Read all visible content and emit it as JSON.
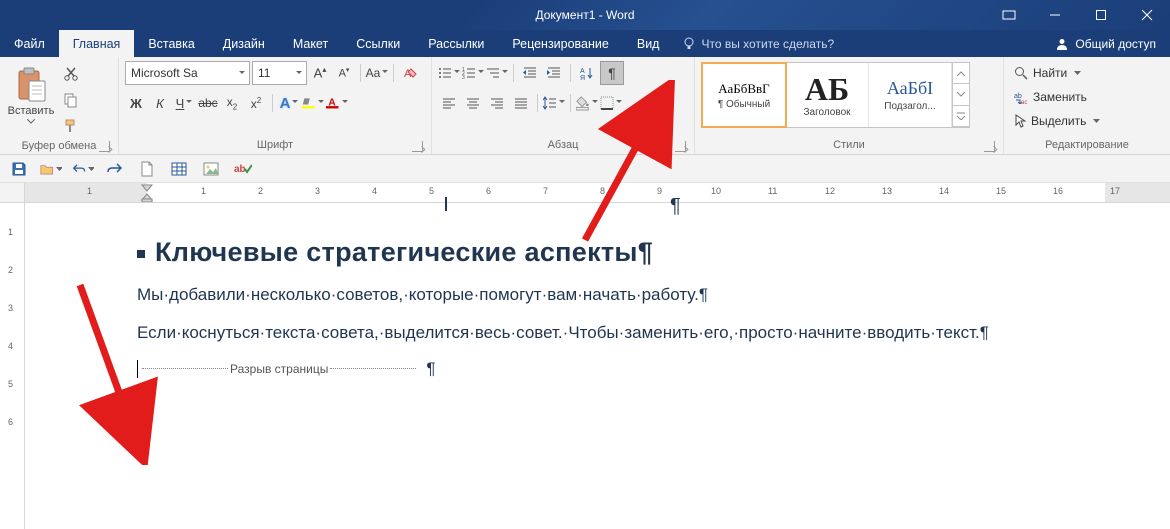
{
  "window": {
    "title": "Документ1 - Word"
  },
  "tabs": {
    "file": "Файл",
    "items": [
      "Главная",
      "Вставка",
      "Дизайн",
      "Макет",
      "Ссылки",
      "Рассылки",
      "Рецензирование",
      "Вид"
    ],
    "active_index": 0,
    "tell_me_placeholder": "Что вы хотите сделать?",
    "share": "Общий доступ"
  },
  "ribbon": {
    "clipboard": {
      "label": "Буфер обмена",
      "paste": "Вставить"
    },
    "font": {
      "label": "Шрифт",
      "name": "Microsoft Sa",
      "size": "11"
    },
    "paragraph": {
      "label": "Абзац"
    },
    "styles": {
      "label": "Стили",
      "items": [
        {
          "preview": "АаБбВвГ",
          "name": "¶ Обычный",
          "selected": true
        },
        {
          "preview": "АБ",
          "name": "Заголовок",
          "selected": false
        },
        {
          "preview": "АаБбІ",
          "name": "Подзагол...",
          "selected": false
        }
      ]
    },
    "editing": {
      "label": "Редактирование",
      "find": "Найти",
      "replace": "Заменить",
      "select": "Выделить"
    }
  },
  "ruler": {
    "h_numbers": [
      "1",
      "1",
      "2",
      "3",
      "4",
      "5",
      "6",
      "7",
      "8",
      "9",
      "10",
      "11",
      "12",
      "13",
      "14",
      "15",
      "16",
      "17"
    ],
    "v_numbers": [
      "1",
      "2",
      "3",
      "4",
      "5",
      "6"
    ]
  },
  "document": {
    "heading": "Ключевые стратегические аспекты",
    "para1": "Мы·добавили·несколько·советов,·которые·помогут·вам·начать·работу.",
    "para2": "Если·коснуться·текста·совета,·выделится·весь·совет.·Чтобы·заменить·его,·просто·начните·вводить·текст.",
    "page_break": "Разрыв страницы",
    "pilcrow": "¶"
  }
}
